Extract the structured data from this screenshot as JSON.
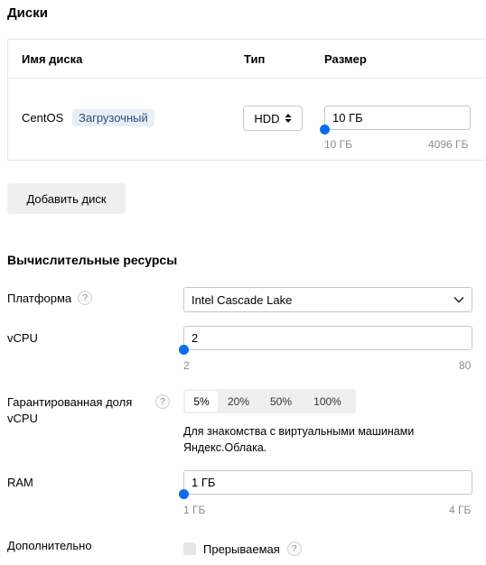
{
  "disks": {
    "title": "Диски",
    "columns": {
      "name": "Имя диска",
      "type": "Тип",
      "size": "Размер"
    },
    "row": {
      "name": "CentOS",
      "badge": "Загрузочный",
      "type_value": "HDD",
      "size_value": "10 ГБ",
      "size_min": "10 ГБ",
      "size_max": "4096 ГБ",
      "size_fraction": 0
    },
    "add_button": "Добавить диск"
  },
  "compute": {
    "title": "Вычислительные ресурсы",
    "platform": {
      "label": "Платформа",
      "value": "Intel Cascade Lake",
      "help": "?"
    },
    "vcpu": {
      "label": "vCPU",
      "value": "2",
      "min": "2",
      "max": "80",
      "fraction": 0
    },
    "guaranteed": {
      "label_line1": "Гарантированная доля",
      "label_line2": "vCPU",
      "help": "?",
      "options": [
        "5%",
        "20%",
        "50%",
        "100%"
      ],
      "selected": "5%",
      "hint_line1": "Для знакомства с виртуальными машинами",
      "hint_line2": "Яндекс.Облака."
    },
    "ram": {
      "label": "RAM",
      "value": "1 ГБ",
      "min": "1 ГБ",
      "max": "4 ГБ",
      "fraction": 0
    },
    "extra": {
      "label": "Дополнительно",
      "checkbox_label": "Прерываемая",
      "checked": false,
      "help": "?"
    }
  },
  "colors": {
    "accent": "#0a6cf5",
    "badge_bg": "#e8eef6",
    "badge_text": "#2d4e78"
  }
}
